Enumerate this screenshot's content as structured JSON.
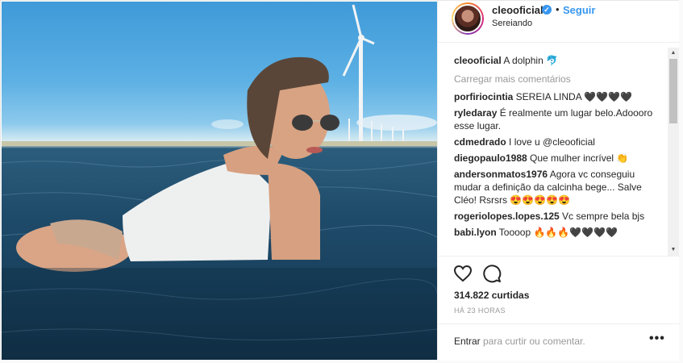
{
  "header": {
    "username": "cleooficial",
    "verified_glyph": "✓",
    "separator": "•",
    "follow_label": "Seguir",
    "location": "Sereiando"
  },
  "caption": {
    "user": "cleooficial",
    "text": " A dolphin 🐬"
  },
  "load_more": "Carregar mais comentários",
  "comments": [
    {
      "user": "porfiriocintia",
      "text": " SEREIA LINDA 🖤🖤🖤🖤"
    },
    {
      "user": "ryledaray",
      "text": " É realmente um lugar belo.Adoooro esse lugar."
    },
    {
      "user": "cdmedrado",
      "text": " I love u @cleooficial"
    },
    {
      "user": "diegopaulo1988",
      "text": " Que mulher incrível 👏"
    },
    {
      "user": "andersonmatos1976",
      "text": " Agora vc conseguiu mudar a definição da calcinha bege... Salve Cléo! Rsrsrs 😍😍😍😍😍"
    },
    {
      "user": "rogeriolopes.lopes.125",
      "text": " Vc sempre bela bjs"
    },
    {
      "user": "babi.lyon",
      "text": " Toooop 🔥🔥🔥🖤🖤🖤🖤"
    }
  ],
  "likes": "314.822 curtidas",
  "timestamp": "HÁ 23 HORAS",
  "add_comment": {
    "login": "Entrar",
    "rest": " para curtir ou comentar."
  },
  "more_glyph": "•••",
  "icons": [
    "heart-icon",
    "comment-icon",
    "verified-icon",
    "more-options-icon"
  ],
  "colors": {
    "link": "#3897f0",
    "muted": "#999999",
    "text": "#262626"
  }
}
